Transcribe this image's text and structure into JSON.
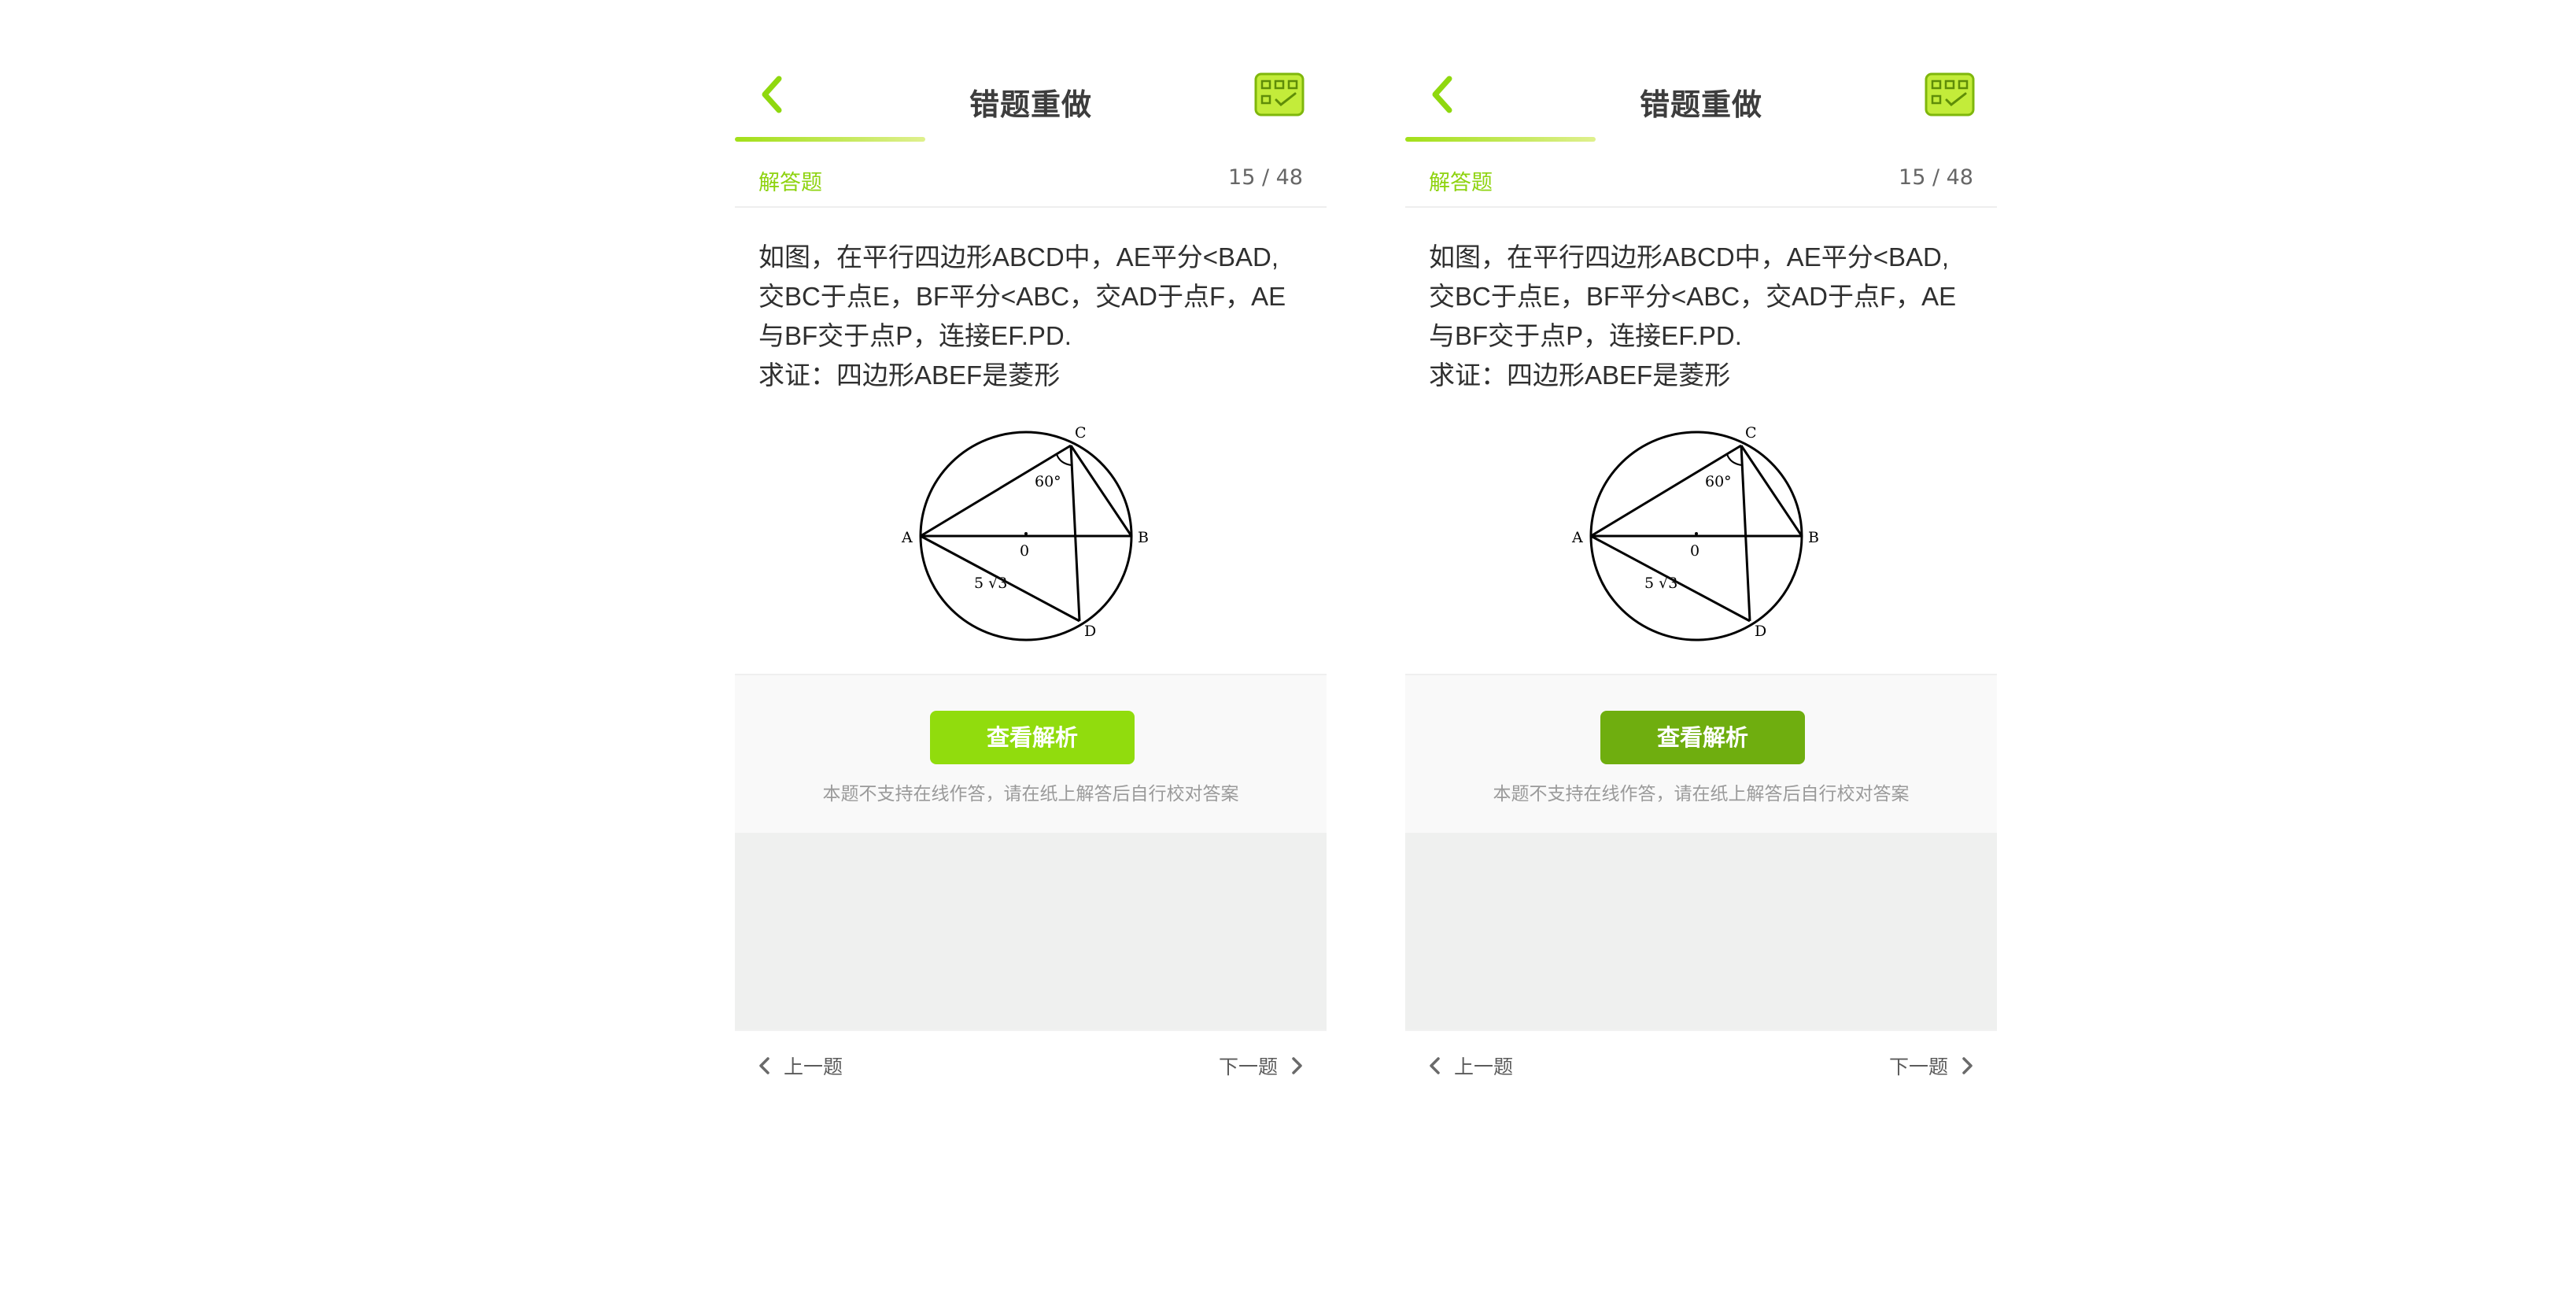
{
  "screens": [
    {
      "header": {
        "title": "错题重做"
      },
      "question_meta": {
        "type": "解答题",
        "count": "15 / 48"
      },
      "question": {
        "lines": [
          "如图，在平行四边形ABCD中，AE平分<BAD,",
          "交BC于点E，BF平分<ABC，交AD于点F，AE",
          "与BF交于点P，连接EF.PD.",
          "求证：四边形ABEF是菱形"
        ]
      },
      "figure": {
        "labels": {
          "a": "A",
          "b": "B",
          "c": "C",
          "d": "D",
          "o": "0",
          "angle": "60°",
          "length": "5 √3"
        }
      },
      "action": {
        "button": "查看解析",
        "hint": "本题不支持在线作答，请在纸上解答后自行校对答案"
      },
      "footer": {
        "prev": "上一题",
        "next": "下一题"
      },
      "colors": {
        "accent": "#91dc0d",
        "button": "#91dc0d"
      }
    },
    {
      "header": {
        "title": "错题重做"
      },
      "question_meta": {
        "type": "解答题",
        "count": "15 / 48"
      },
      "question": {
        "lines": [
          "如图，在平行四边形ABCD中，AE平分<BAD,",
          "交BC于点E，BF平分<ABC，交AD于点F，AE",
          "与BF交于点P，连接EF.PD.",
          "求证：四边形ABEF是菱形"
        ]
      },
      "figure": {
        "labels": {
          "a": "A",
          "b": "B",
          "c": "C",
          "d": "D",
          "o": "0",
          "angle": "60°",
          "length": "5 √3"
        }
      },
      "action": {
        "button": "查看解析",
        "hint": "本题不支持在线作答，请在纸上解答后自行校对答案"
      },
      "footer": {
        "prev": "上一题",
        "next": "下一题"
      },
      "colors": {
        "accent": "#91dc0d",
        "button": "#6fae0f"
      }
    }
  ]
}
